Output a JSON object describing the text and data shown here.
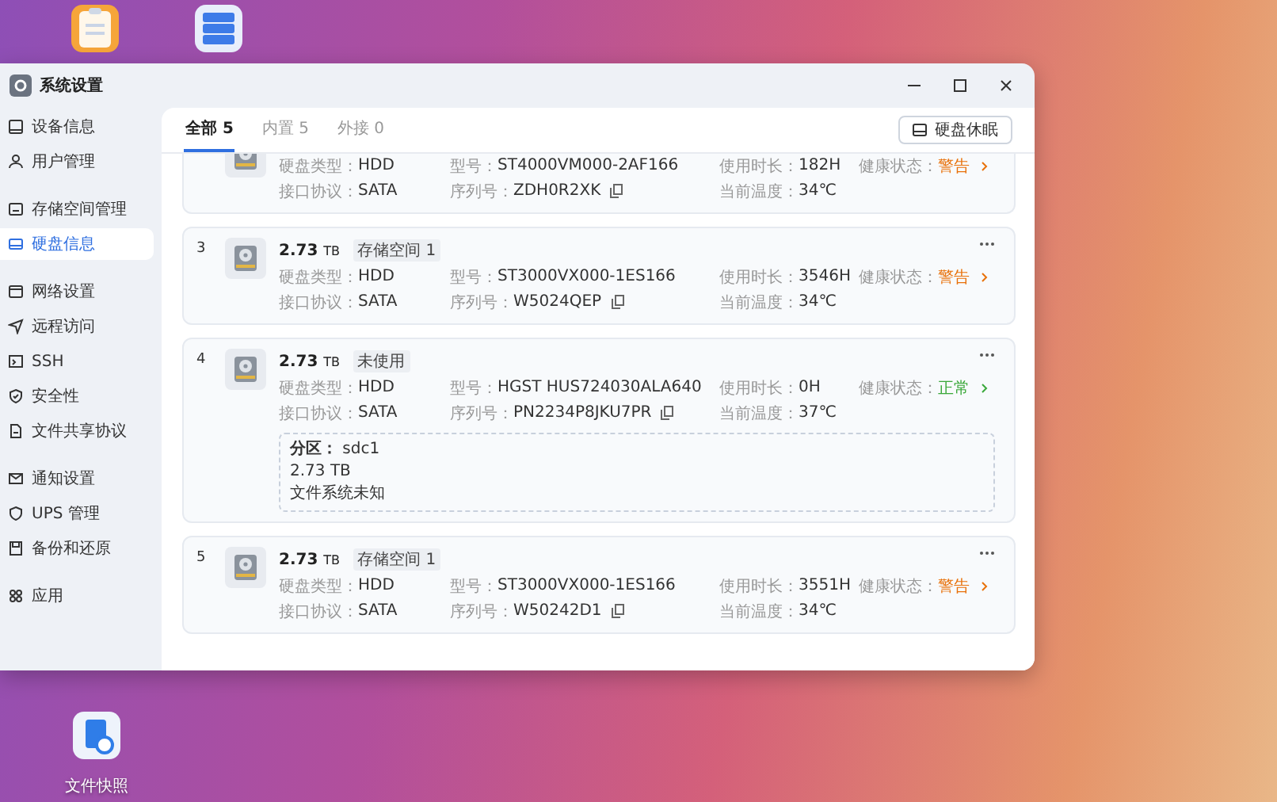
{
  "desktop_top_icons": [
    {
      "kind": "clipboard"
    },
    {
      "kind": "server"
    }
  ],
  "window": {
    "title": "系统设置"
  },
  "sidebar": {
    "groups": [
      {
        "items": [
          {
            "kind": "monitor",
            "label": "设备信息",
            "selected": false
          },
          {
            "kind": "user",
            "label": "用户管理",
            "selected": false
          }
        ]
      },
      {
        "items": [
          {
            "kind": "storage",
            "label": "存储空间管理",
            "selected": false
          },
          {
            "kind": "disk",
            "label": "硬盘信息",
            "selected": true
          }
        ]
      },
      {
        "items": [
          {
            "kind": "window",
            "label": "网络设置",
            "selected": false
          },
          {
            "kind": "send",
            "label": "远程访问",
            "selected": false
          },
          {
            "kind": "terminal",
            "label": "SSH",
            "selected": false
          },
          {
            "kind": "shield",
            "label": "安全性",
            "selected": false
          },
          {
            "kind": "file",
            "label": "文件共享协议",
            "selected": false
          }
        ]
      },
      {
        "items": [
          {
            "kind": "mail",
            "label": "通知设置",
            "selected": false
          },
          {
            "kind": "shield-plain",
            "label": "UPS 管理",
            "selected": false
          },
          {
            "kind": "save",
            "label": "备份和还原",
            "selected": false
          }
        ]
      },
      {
        "items": [
          {
            "kind": "apps",
            "label": "应用",
            "selected": false
          }
        ]
      }
    ]
  },
  "tabs": [
    {
      "label": "全部 5",
      "selected": true
    },
    {
      "label": "内置 5",
      "selected": false
    },
    {
      "label": "外接 0",
      "selected": false
    }
  ],
  "sleep_button": "硬盘休眠",
  "disks": [
    {
      "fields": [
        {
          "kind": "plain",
          "label": "硬盘类型：",
          "value": "HDD"
        },
        {
          "kind": "plain",
          "label": "型号：",
          "value": "ST4000VM000-2AF166"
        },
        {
          "kind": "plain",
          "label": "使用时长：",
          "value": "182H"
        },
        {
          "kind": "health",
          "label": "健康状态：",
          "value": "警告",
          "color": "#e8710a"
        },
        {
          "kind": "plain",
          "label": "接口协议：",
          "value": "SATA"
        },
        {
          "kind": "copyable",
          "label": "序列号：",
          "value": "ZDH0R2XK"
        },
        {
          "kind": "plain",
          "label": "当前温度：",
          "value": "34℃"
        }
      ]
    },
    {
      "number": "3",
      "size": "2.73",
      "unit": "TB",
      "tag": "存储空间 1",
      "fields": [
        {
          "kind": "plain",
          "label": "硬盘类型：",
          "value": "HDD"
        },
        {
          "kind": "plain",
          "label": "型号：",
          "value": "ST3000VX000-1ES166"
        },
        {
          "kind": "plain",
          "label": "使用时长：",
          "value": "3546H"
        },
        {
          "kind": "health",
          "label": "健康状态：",
          "value": "警告",
          "color": "#e8710a"
        },
        {
          "kind": "plain",
          "label": "接口协议：",
          "value": "SATA"
        },
        {
          "kind": "copyable",
          "label": "序列号：",
          "value": "W5024QEP"
        },
        {
          "kind": "plain",
          "label": "当前温度：",
          "value": "34℃"
        }
      ]
    },
    {
      "number": "4",
      "size": "2.73",
      "unit": "TB",
      "tag": "未使用",
      "fields": [
        {
          "kind": "plain",
          "label": "硬盘类型：",
          "value": "HDD"
        },
        {
          "kind": "plain",
          "label": "型号：",
          "value": "HGST HUS724030ALA640"
        },
        {
          "kind": "plain",
          "label": "使用时长：",
          "value": "0H"
        },
        {
          "kind": "health",
          "label": "健康状态：",
          "value": "正常",
          "color": "#3aa83a"
        },
        {
          "kind": "plain",
          "label": "接口协议：",
          "value": "SATA"
        },
        {
          "kind": "copyable",
          "label": "序列号：",
          "value": "PN2234P8JKU7PR"
        },
        {
          "kind": "plain",
          "label": "当前温度：",
          "value": "37℃"
        }
      ],
      "partition": {
        "title": "**分区：** sdc1",
        "size": "2.73 TB",
        "fs": "文件系统未知"
      }
    },
    {
      "number": "5",
      "size": "2.73",
      "unit": "TB",
      "tag": "存储空间 1",
      "fields": [
        {
          "kind": "plain",
          "label": "硬盘类型：",
          "value": "HDD"
        },
        {
          "kind": "plain",
          "label": "型号：",
          "value": "ST3000VX000-1ES166"
        },
        {
          "kind": "plain",
          "label": "使用时长：",
          "value": "3551H"
        },
        {
          "kind": "health",
          "label": "健康状态：",
          "value": "警告",
          "color": "#e8710a"
        },
        {
          "kind": "plain",
          "label": "接口协议：",
          "value": "SATA"
        },
        {
          "kind": "copyable",
          "label": "序列号：",
          "value": "W50242D1"
        },
        {
          "kind": "plain",
          "label": "当前温度：",
          "value": "34℃"
        }
      ]
    }
  ],
  "desktop_icons": [
    {
      "kind": "snapshot",
      "label": "文件快照"
    }
  ]
}
